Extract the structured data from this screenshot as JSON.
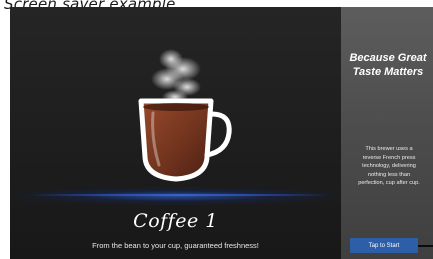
{
  "caption": "Screen saver example",
  "main": {
    "title": "Coffee 1",
    "tagline": "From the bean to your cup, guaranteed freshness!"
  },
  "side": {
    "heading_line1": "Because Great",
    "heading_line2": "Taste Matters",
    "body_lines": [
      "This brewer uses a",
      "reverse French press",
      "technology, delivering",
      "nothing less than",
      "perfection, cup after cup."
    ],
    "button_label": "Tap to Start"
  },
  "colors": {
    "accent_blue": "#2d5ea8",
    "coffee": "#7a3a22",
    "panel_dark": "#1c1c1c",
    "panel_gray": "#555555"
  },
  "icons": {
    "cup": "coffee-cup-icon",
    "steam": "steam-icon"
  }
}
